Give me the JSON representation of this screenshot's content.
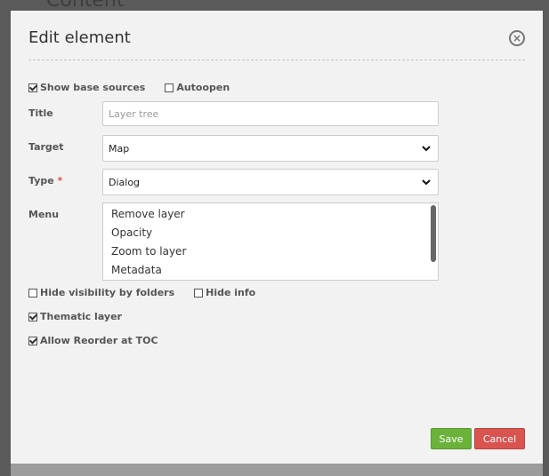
{
  "background": {
    "heading": "Content"
  },
  "modal": {
    "title": "Edit element",
    "close_icon": "close-circle-icon"
  },
  "top_checks": [
    {
      "label": "Show base sources",
      "checked": true
    },
    {
      "label": "Autoopen",
      "checked": false
    }
  ],
  "form": {
    "title_label": "Title",
    "title_placeholder": "Layer tree",
    "title_value": "",
    "target_label": "Target",
    "target_value": "Map",
    "type_label": "Type",
    "type_required_marker": "*",
    "type_value": "Dialog",
    "menu_label": "Menu",
    "menu_options": [
      "Remove layer",
      "Opacity",
      "Zoom to layer",
      "Metadata"
    ]
  },
  "bottom_checks": {
    "hide_visibility": {
      "label": "Hide visibility by folders",
      "checked": false
    },
    "hide_info": {
      "label": "Hide info",
      "checked": false
    },
    "thematic_layer": {
      "label": "Thematic layer",
      "checked": true
    },
    "allow_reorder": {
      "label": "Allow Reorder at TOC",
      "checked": true
    }
  },
  "buttons": {
    "save": "Save",
    "cancel": "Cancel"
  },
  "colors": {
    "save": "#6bb23a",
    "cancel": "#d9534f",
    "required": "#d9534f"
  }
}
